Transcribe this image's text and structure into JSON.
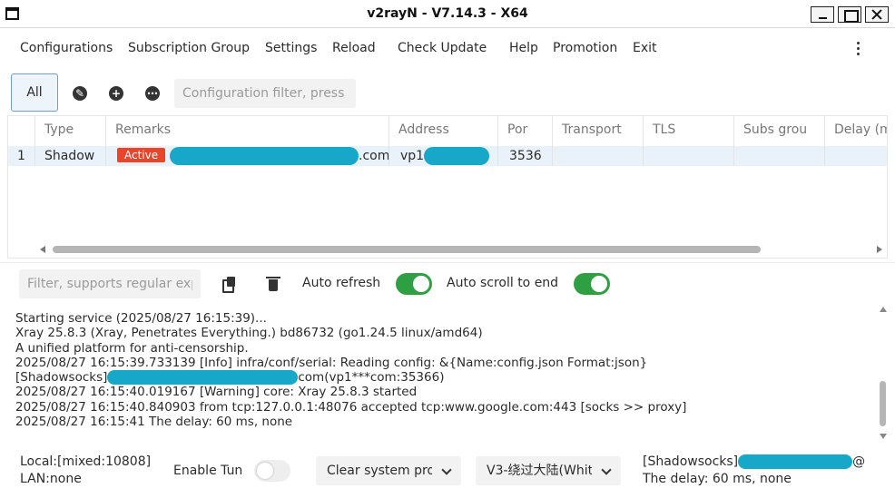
{
  "window": {
    "title": "v2rayN - V7.14.3 - X64"
  },
  "menu": {
    "items": [
      "Configurations",
      "Subscription Group",
      "Settings",
      "Reload",
      "Check Update",
      "Help",
      "Promotion",
      "Exit"
    ]
  },
  "toolbar": {
    "all_tab": "All",
    "filter_placeholder": "Configuration filter, press"
  },
  "table": {
    "columns": [
      "Type",
      "Remarks",
      "Address",
      "Por",
      "Transport",
      "TLS",
      "Subs grou",
      "Delay (m"
    ],
    "rows": [
      {
        "index": "1",
        "type": "Shadow",
        "badge": "Active",
        "remarks_suffix": ".com",
        "address_prefix": "vp1",
        "port": "3536"
      }
    ]
  },
  "log": {
    "filter_placeholder": "Filter, supports regular exp",
    "auto_refresh_label": "Auto refresh",
    "auto_refresh_on": true,
    "auto_scroll_label": "Auto scroll to end",
    "auto_scroll_on": true,
    "lines": [
      "Starting service (2025/08/27 16:15:39)...",
      "Xray 25.8.3 (Xray, Penetrates Everything.) bd86732 (go1.24.5 linux/amd64)",
      "A unified platform for anti-censorship.",
      "2025/08/27 16:15:39.733139 [Info] infra/conf/serial: Reading config: &{Name:config.json Format:json}",
      "[Shadowsocks]",
      "2025/08/27 16:15:40.019167 [Warning] core: Xray 25.8.3 started",
      "2025/08/27 16:15:40.840903 from tcp:127.0.0.1:48076 accepted tcp:www.google.com:443 [socks >> proxy]",
      "2025/08/27 16:15:41 The delay: 60 ms, none"
    ],
    "line5_suffix": "com(vp1***com:35366)"
  },
  "status": {
    "local": "Local:[mixed:10808]",
    "lan": "LAN:none",
    "enable_tun_label": "Enable Tun",
    "enable_tun_on": false,
    "proxy_select": "Clear system pro",
    "routing_select": "V3-绕过大陆(Whit",
    "server_label": "[Shadowsocks]",
    "server_suffix": "@",
    "delay": "The delay: 60 ms, none"
  },
  "colors": {
    "accent_green": "#2ea043",
    "badge_red": "#e8452a",
    "redaction": "#17a8c9",
    "selected_row": "#e9f1fb"
  }
}
